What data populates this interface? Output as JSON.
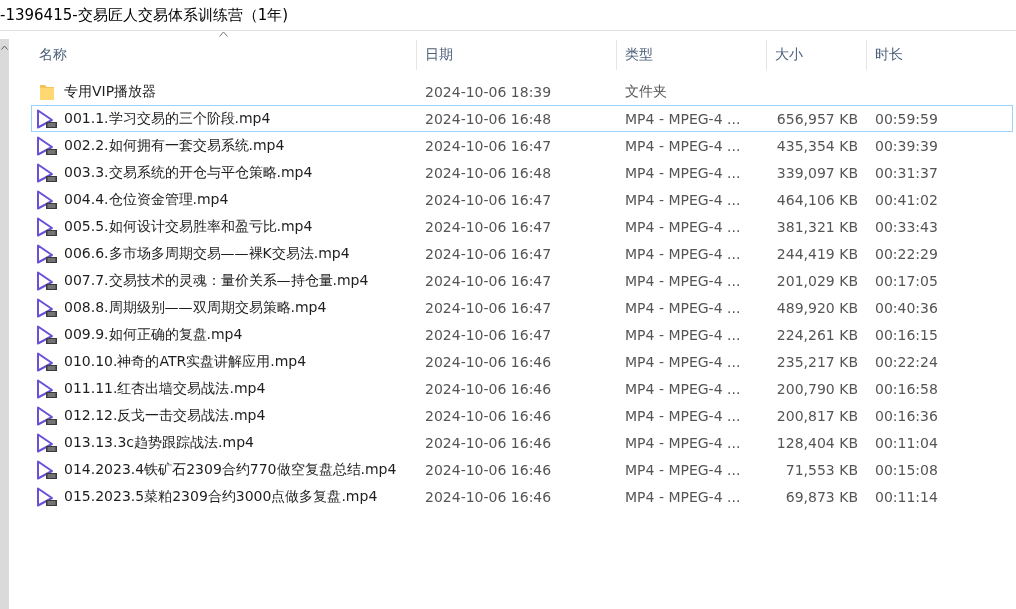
{
  "window": {
    "title": "-1396415-交易匠人交易体系训练营（1年)"
  },
  "columns": [
    {
      "label": "名称",
      "sorted": true
    },
    {
      "label": "日期",
      "sorted": false
    },
    {
      "label": "类型",
      "sorted": false
    },
    {
      "label": "大小",
      "sorted": false
    },
    {
      "label": "时长",
      "sorted": false
    }
  ],
  "rows": [
    {
      "kind": "folder",
      "name": "专用VIP播放器",
      "date": "2024-10-06 18:39",
      "type": "文件夹",
      "selected": false
    },
    {
      "kind": "video",
      "name": "001.1.学习交易的三个阶段.mp4",
      "date": "2024-10-06 16:48",
      "type": "MP4 - MPEG-4 ...",
      "size": "656,957 KB",
      "duration": "00:59:59",
      "selected": true
    },
    {
      "kind": "video",
      "name": "002.2.如何拥有一套交易系统.mp4",
      "date": "2024-10-06 16:47",
      "type": "MP4 - MPEG-4 ...",
      "size": "435,354 KB",
      "duration": "00:39:39",
      "selected": false
    },
    {
      "kind": "video",
      "name": "003.3.交易系统的开仓与平仓策略.mp4",
      "date": "2024-10-06 16:48",
      "type": "MP4 - MPEG-4 ...",
      "size": "339,097 KB",
      "duration": "00:31:37",
      "selected": false
    },
    {
      "kind": "video",
      "name": "004.4.仓位资金管理.mp4",
      "date": "2024-10-06 16:47",
      "type": "MP4 - MPEG-4 ...",
      "size": "464,106 KB",
      "duration": "00:41:02",
      "selected": false
    },
    {
      "kind": "video",
      "name": "005.5.如何设计交易胜率和盈亏比.mp4",
      "date": "2024-10-06 16:47",
      "type": "MP4 - MPEG-4 ...",
      "size": "381,321 KB",
      "duration": "00:33:43",
      "selected": false
    },
    {
      "kind": "video",
      "name": "006.6.多市场多周期交易——裸K交易法.mp4",
      "date": "2024-10-06 16:47",
      "type": "MP4 - MPEG-4 ...",
      "size": "244,419 KB",
      "duration": "00:22:29",
      "selected": false
    },
    {
      "kind": "video",
      "name": "007.7.交易技术的灵魂：量价关系—持仓量.mp4",
      "date": "2024-10-06 16:47",
      "type": "MP4 - MPEG-4 ...",
      "size": "201,029 KB",
      "duration": "00:17:05",
      "selected": false
    },
    {
      "kind": "video",
      "name": "008.8.周期级别——双周期交易策略.mp4",
      "date": "2024-10-06 16:47",
      "type": "MP4 - MPEG-4 ...",
      "size": "489,920 KB",
      "duration": "00:40:36",
      "selected": false
    },
    {
      "kind": "video",
      "name": "009.9.如何正确的复盘.mp4",
      "date": "2024-10-06 16:47",
      "type": "MP4 - MPEG-4 ...",
      "size": "224,261 KB",
      "duration": "00:16:15",
      "selected": false
    },
    {
      "kind": "video",
      "name": "010.10.神奇的ATR实盘讲解应用.mp4",
      "date": "2024-10-06 16:46",
      "type": "MP4 - MPEG-4 ...",
      "size": "235,217 KB",
      "duration": "00:22:24",
      "selected": false
    },
    {
      "kind": "video",
      "name": "011.11.红杏出墙交易战法.mp4",
      "date": "2024-10-06 16:46",
      "type": "MP4 - MPEG-4 ...",
      "size": "200,790 KB",
      "duration": "00:16:58",
      "selected": false
    },
    {
      "kind": "video",
      "name": "012.12.反戈一击交易战法.mp4",
      "date": "2024-10-06 16:46",
      "type": "MP4 - MPEG-4 ...",
      "size": "200,817 KB",
      "duration": "00:16:36",
      "selected": false
    },
    {
      "kind": "video",
      "name": "013.13.3c趋势跟踪战法.mp4",
      "date": "2024-10-06 16:46",
      "type": "MP4 - MPEG-4 ...",
      "size": "128,404 KB",
      "duration": "00:11:04",
      "selected": false
    },
    {
      "kind": "video",
      "name": "014.2023.4铁矿石2309合约770做空复盘总结.mp4",
      "date": "2024-10-06 16:46",
      "type": "MP4 - MPEG-4 ...",
      "size": "71,553 KB",
      "duration": "00:15:08",
      "selected": false
    },
    {
      "kind": "video",
      "name": "015.2023.5菜粕2309合约3000点做多复盘.mp4",
      "date": "2024-10-06 16:46",
      "type": "MP4 - MPEG-4 ...",
      "size": "69,873 KB",
      "duration": "00:11:14",
      "selected": false
    }
  ]
}
